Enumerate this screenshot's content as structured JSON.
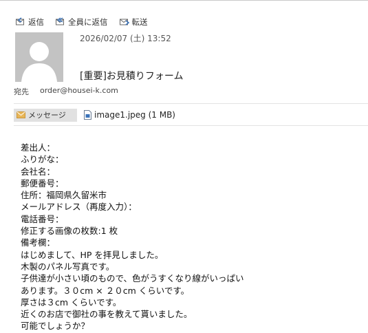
{
  "toolbar": {
    "reply_label": "返信",
    "reply_all_label": "全員に返信",
    "forward_label": "転送"
  },
  "header": {
    "date": "2026/02/07 (土) 13:52",
    "subject": "[重要]お見積りフォーム",
    "to_label": "宛先",
    "to_address": "order@housei-k.com"
  },
  "attachments": {
    "message_tab_label": "メッセージ",
    "file_label": "image1.jpeg (1 MB)"
  },
  "body_lines": [
    "差出人：",
    "ふりがな：",
    "会社名：",
    "郵便番号：",
    "住所：福岡県久留米市",
    "メールアドレス（再度入力）：",
    "電話番号：",
    "修正する画像の枚数:1 枚",
    "備考欄：",
    "はじめまして、HP を拝見しました。",
    "木製のパネル写真です。",
    "子供達が小さい頃のもので、色がうすくなり線がいっぱい",
    "あります。３０cm × ２０cm くらいです。",
    "厚さは３cm くらいです。",
    "近くのお店で御社の事を教えて貰いました。",
    "可能でしょうか？"
  ],
  "colors": {
    "icon_blue": "#3b73b9",
    "avatar_bg": "#c3c3c3",
    "message_tab_bg": "#e1e1e1",
    "envelope": "#e8b658"
  }
}
